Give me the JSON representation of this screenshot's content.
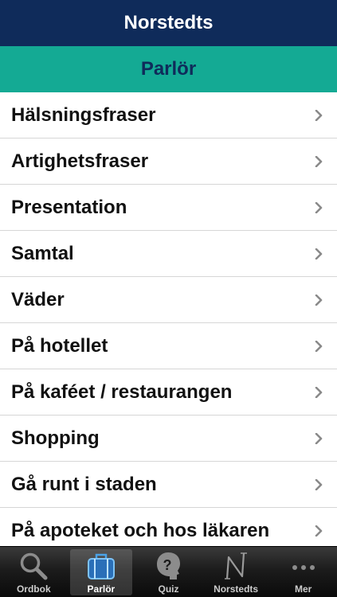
{
  "header": {
    "title": "Norstedts"
  },
  "section": {
    "title": "Parlör"
  },
  "list": {
    "items": [
      {
        "label": "Hälsningsfraser"
      },
      {
        "label": "Artighetsfraser"
      },
      {
        "label": "Presentation"
      },
      {
        "label": "Samtal"
      },
      {
        "label": "Väder"
      },
      {
        "label": "På hotellet"
      },
      {
        "label": "På kaféet / restaurangen"
      },
      {
        "label": "Shopping"
      },
      {
        "label": "Gå runt i staden"
      },
      {
        "label": "På apoteket och hos läkaren"
      }
    ]
  },
  "tabbar": {
    "selected": "Parlör",
    "tabs": [
      {
        "label": "Ordbok",
        "icon": "search-icon"
      },
      {
        "label": "Parlör",
        "icon": "suitcase-icon"
      },
      {
        "label": "Quiz",
        "icon": "question-head-icon"
      },
      {
        "label": "Norstedts",
        "icon": "norstedts-logo-icon"
      },
      {
        "label": "Mer",
        "icon": "more-icon"
      }
    ]
  },
  "colors": {
    "nav_bar": "#0f2b5a",
    "section_bar": "#14aa94",
    "selected_tab_icon": "#4aa3e8"
  }
}
